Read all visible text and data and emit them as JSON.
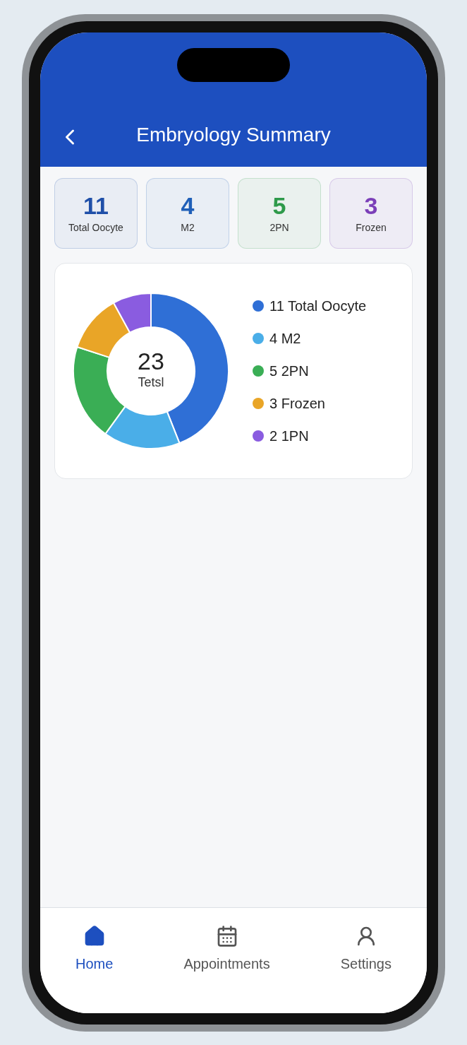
{
  "header": {
    "title": "Embryology Summary"
  },
  "stats": [
    {
      "value": "11",
      "label": "Total Oocyte",
      "color": "#1f4fa8"
    },
    {
      "value": "4",
      "label": "M2",
      "color": "#1f5fb8"
    },
    {
      "value": "5",
      "label": "2PN",
      "color": "#2e9a4a"
    },
    {
      "value": "3",
      "label": "Frozen",
      "color": "#7b3fb8"
    }
  ],
  "summary": {
    "total": "23",
    "total_label": "Tetsl",
    "chart_data": {
      "type": "donut",
      "categories": [
        "11 Total Oocyte",
        "4 M2",
        "5 2PN",
        "3 Frozen",
        "2 1PN"
      ],
      "values": [
        11,
        4,
        5,
        3,
        2
      ],
      "colors": [
        "#2f6fd6",
        "#4aaee8",
        "#3aae55",
        "#e9a527",
        "#8a5ce0"
      ]
    }
  },
  "nav": [
    {
      "label": "Home",
      "selected": true
    },
    {
      "label": "Appointments",
      "selected": false
    },
    {
      "label": "Settings",
      "selected": false
    }
  ]
}
